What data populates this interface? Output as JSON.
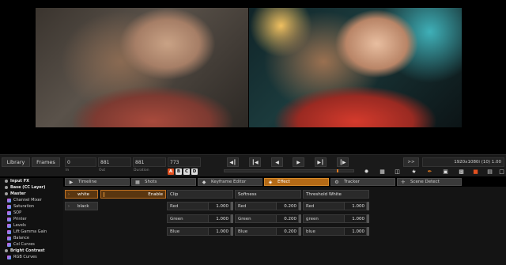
{
  "toolbar": {
    "library_label": "Library",
    "frames_label": "Frames",
    "in_value": "0",
    "in_label": "In",
    "out_value": "881",
    "out_label": "Out",
    "duration_value": "881",
    "duration_label": "Duration",
    "current_frame": "773",
    "channel_a": "A",
    "channel_b": "B",
    "channel_c": "C",
    "channel_d": "D",
    "expand_label": ">>",
    "resolution_info": "1920x1080i (10) 1.00"
  },
  "tabs": [
    {
      "label": "Timeline",
      "icon": "play-icon"
    },
    {
      "label": "Shots",
      "icon": "grid-icon"
    },
    {
      "label": "Keyframe Editor",
      "icon": "keyframe-icon"
    },
    {
      "label": "Effect",
      "icon": "cube-icon"
    },
    {
      "label": "Tracker",
      "icon": "gear-icon"
    },
    {
      "label": "Scene Detect",
      "icon": "scene-icon"
    }
  ],
  "layers": [
    {
      "label": "Input FX",
      "bold": true
    },
    {
      "label": "Base (CC Layer)",
      "bold": true
    },
    {
      "label": "Master",
      "bold": true
    },
    {
      "label": "Channel Mixer",
      "bold": false
    },
    {
      "label": "Saturation",
      "bold": false
    },
    {
      "label": "SOP",
      "bold": false
    },
    {
      "label": "Printer",
      "bold": false
    },
    {
      "label": "Levels",
      "bold": false
    },
    {
      "label": "Lift Gamma Gain",
      "bold": false
    },
    {
      "label": "Balance",
      "bold": false
    },
    {
      "label": "Col Curves",
      "bold": false
    },
    {
      "label": "Bright Contrast",
      "bold": true
    },
    {
      "label": "RGB Curves",
      "bold": false
    }
  ],
  "effect": {
    "list": [
      "white",
      "black"
    ],
    "enable_label": "Enable",
    "groups": [
      {
        "title": "Clip",
        "rows": [
          {
            "label": "Red",
            "value": "1.000"
          },
          {
            "label": "Green",
            "value": "1.000"
          },
          {
            "label": "Blue",
            "value": "1.000"
          }
        ]
      },
      {
        "title": "Softness",
        "rows": [
          {
            "label": "Red",
            "value": "0.200"
          },
          {
            "label": "Green",
            "value": "0.200"
          },
          {
            "label": "Blue",
            "value": "0.200"
          }
        ]
      },
      {
        "title": "Threshold White",
        "rows": [
          {
            "label": "Red",
            "value": "1.000"
          },
          {
            "label": "green",
            "value": "1.000"
          },
          {
            "label": "blue",
            "value": "1.000"
          }
        ]
      }
    ]
  },
  "colors": {
    "accent": "#b46a16",
    "channel_a": "#e05020",
    "marker": "#e07a20"
  }
}
